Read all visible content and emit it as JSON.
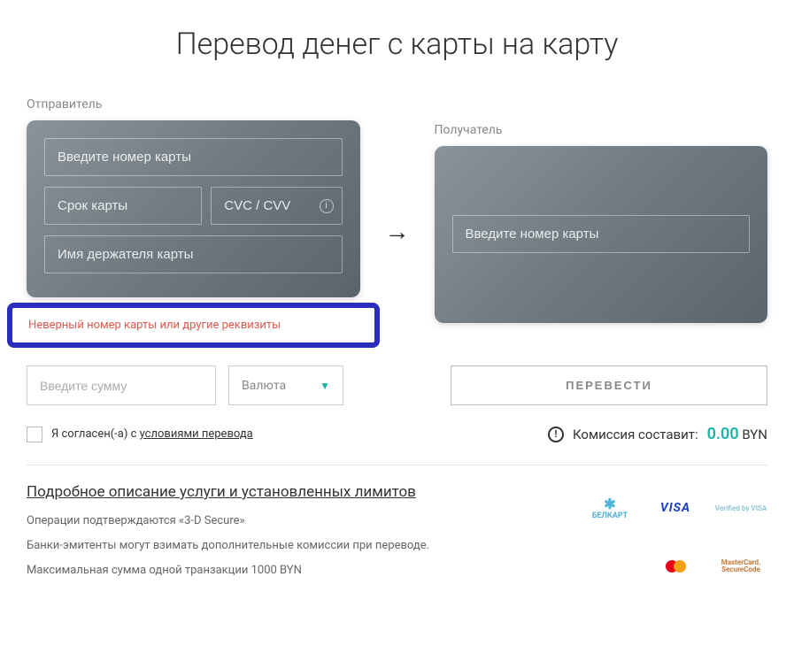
{
  "title": "Перевод денег с карты на карту",
  "sender": {
    "label": "Отправитель",
    "card_number_placeholder": "Введите номер карты",
    "expiry_placeholder": "Срок карты",
    "cvv_placeholder": "CVC / CVV",
    "holder_placeholder": "Имя держателя карты"
  },
  "recipient": {
    "label": "Получатель",
    "card_number_placeholder": "Введите номер карты"
  },
  "error_message": "Неверный номер карты или другие реквизиты",
  "amount_placeholder": "Введите сумму",
  "currency_label": "Валюта",
  "transfer_button": "ПЕРЕВЕСТИ",
  "agree": {
    "prefix": "Я  согласен(-а)  с ",
    "link": "условиями перевода"
  },
  "commission": {
    "label": "Комиссия составит:",
    "amount": "0.00",
    "currency": "BYN"
  },
  "details": {
    "heading": "Подробное описание услуги и установленных лимитов",
    "lines": [
      "Операции подтверждаются «3-D Secure»",
      "Банки-эмитенты могут взимать дополнительные комиссии при переводе.",
      "Максимальная сумма одной транзакции 1000 BYN"
    ]
  },
  "logos": {
    "belcart": "БЕЛКАРТ",
    "visa": "VISA",
    "verified": "Verified by VISA",
    "mastercard": "mastercard",
    "securecode": "MasterCard. SecureCode"
  }
}
